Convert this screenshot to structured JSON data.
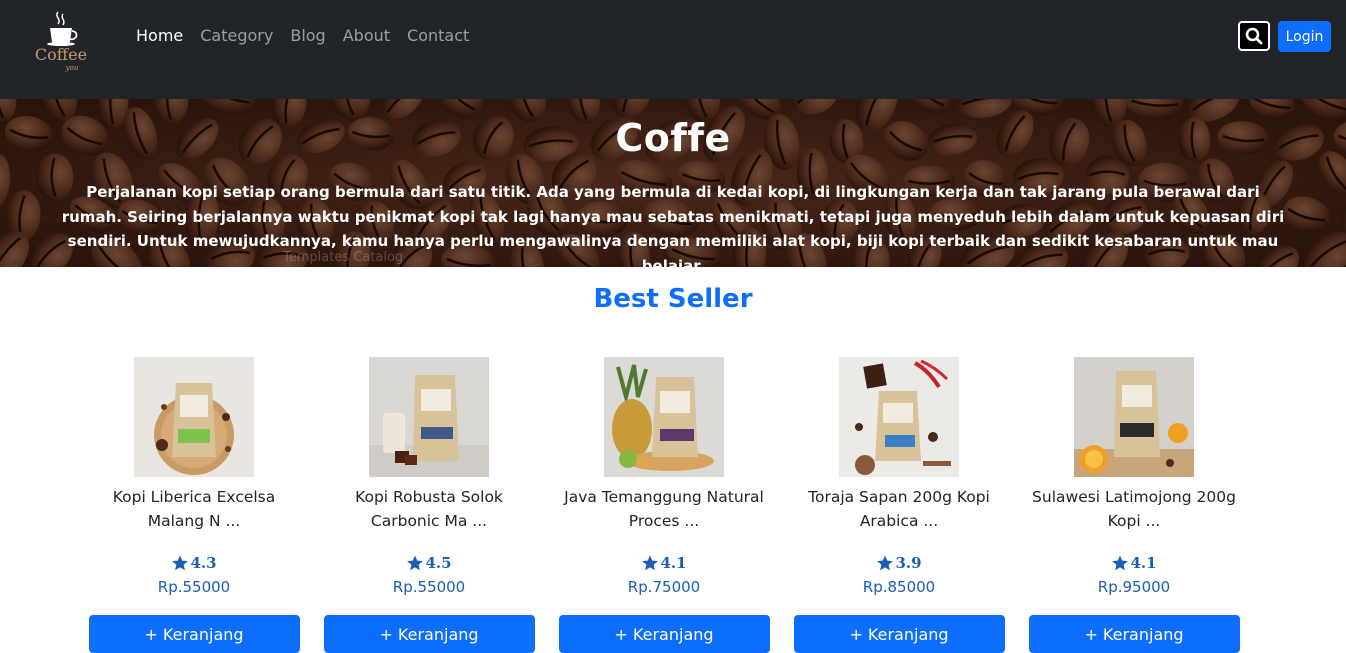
{
  "brand": {
    "logo_text": "Coffee",
    "logo_subtext": "you"
  },
  "nav": {
    "links": [
      {
        "label": "Home",
        "active": true
      },
      {
        "label": "Category",
        "active": false
      },
      {
        "label": "Blog",
        "active": false
      },
      {
        "label": "About",
        "active": false
      },
      {
        "label": "Contact",
        "active": false
      }
    ],
    "search_icon": "search-icon",
    "login_label": "Login"
  },
  "hero": {
    "title": "Coffe",
    "text": "Perjalanan kopi setiap orang bermula dari satu titik. Ada yang bermula di kedai kopi, di lingkungan kerja dan tak jarang pula berawal dari rumah. Seiring berjalannya waktu penikmat kopi tak lagi hanya mau sebatas menikmati, tetapi juga menyeduh lebih dalam untuk kepuasan diri sendiri. Untuk mewujudkannya, kamu hanya perlu mengawalinya dengan memiliki alat kopi, biji kopi terbaik dan sedikit kesabaran untuk mau belajar.",
    "watermark": "Templates Catalog"
  },
  "best_seller": {
    "title": "Best Seller",
    "products": [
      {
        "name": "Kopi Liberica Excelsa Malang N ...",
        "rating": "4.3",
        "price": "Rp.55000",
        "cart_label": "+ Keranjang"
      },
      {
        "name": "Kopi Robusta Solok Carbonic Ma ...",
        "rating": "4.5",
        "price": "Rp.55000",
        "cart_label": "+ Keranjang"
      },
      {
        "name": "Java Temanggung Natural Proces ...",
        "rating": "4.1",
        "price": "Rp.75000",
        "cart_label": "+ Keranjang"
      },
      {
        "name": "Toraja Sapan 200g Kopi Arabica ...",
        "rating": "3.9",
        "price": "Rp.85000",
        "cart_label": "+ Keranjang"
      },
      {
        "name": "Sulawesi Latimojong 200g Kopi ...",
        "rating": "4.1",
        "price": "Rp.95000",
        "cart_label": "+ Keranjang"
      }
    ]
  },
  "colors": {
    "navbar": "#212529",
    "accent": "#0d6efd",
    "price": "#1a5fb4"
  }
}
